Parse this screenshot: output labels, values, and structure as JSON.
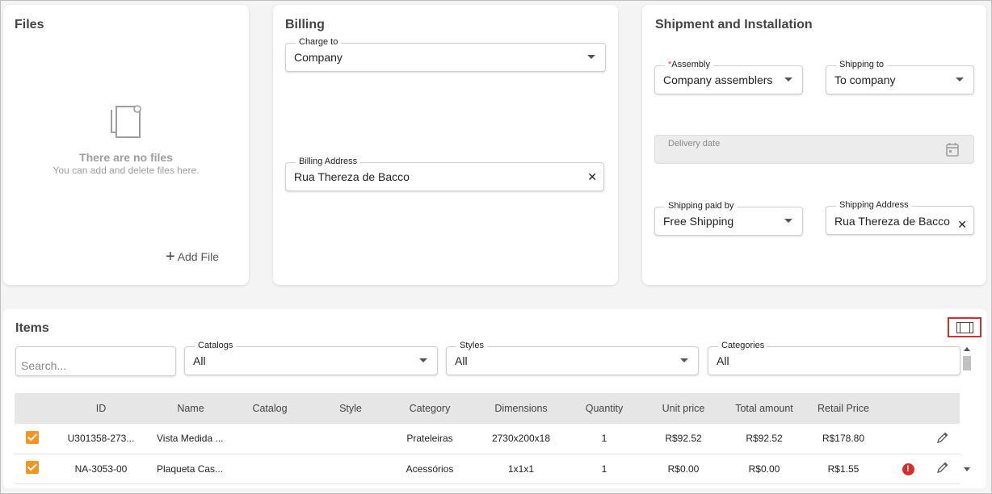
{
  "files": {
    "title": "Files",
    "empty_title": "There are no files",
    "empty_subtitle": "You can add and delete files here.",
    "add_label": "Add File"
  },
  "billing": {
    "title": "Billing",
    "charge_to": {
      "label": "Charge to",
      "value": "Company"
    },
    "billing_address": {
      "label": "Billing Address",
      "value": "Rua Thereza de Bacco"
    }
  },
  "shipment": {
    "title": "Shipment and Installation",
    "assembly": {
      "required_mark": "*",
      "label": "Assembly",
      "value": "Company assemblers"
    },
    "shipping_to": {
      "label": "Shipping to",
      "value": "To company"
    },
    "delivery_date": {
      "label": "Delivery date"
    },
    "shipping_paid_by": {
      "label": "Shipping paid by",
      "value": "Free Shipping"
    },
    "shipping_address": {
      "label": "Shipping Address",
      "value": "Rua Thereza de Bacco"
    }
  },
  "items": {
    "title": "Items",
    "search_placeholder": "Search...",
    "catalogs": {
      "label": "Catalogs",
      "value": "All"
    },
    "styles": {
      "label": "Styles",
      "value": "All"
    },
    "categories": {
      "label": "Categories",
      "value": "All"
    },
    "columns": [
      "ID",
      "Name",
      "Catalog",
      "Style",
      "Category",
      "Dimensions",
      "Quantity",
      "Unit price",
      "Total amount",
      "Retail Price"
    ],
    "rows": [
      {
        "checked": true,
        "id": "U301358-273...",
        "name": "Vista Medida ...",
        "catalog": "",
        "style": "",
        "category": "Prateleiras",
        "dimensions": "2730x200x18",
        "quantity": "1",
        "unit_price": "R$92.52",
        "total_amount": "R$92.52",
        "retail_price": "R$178.80",
        "error": false
      },
      {
        "checked": true,
        "id": "NA-3053-00",
        "name": "Plaqueta Cas...",
        "catalog": "",
        "style": "",
        "category": "Acessórios",
        "dimensions": "1x1x1",
        "quantity": "1",
        "unit_price": "R$0.00",
        "total_amount": "R$0.00",
        "retail_price": "R$1.55",
        "error": true,
        "error_symbol": "!"
      }
    ]
  },
  "colors": {
    "accent": "#f7941d",
    "error": "#d32f2f",
    "highlight_box": "#d32f2f"
  },
  "icons": [
    "file-icon",
    "plus-icon",
    "caret-down-icon",
    "clear-icon",
    "calendar-icon",
    "columns-icon",
    "edit-pencil-icon",
    "error-icon"
  ]
}
